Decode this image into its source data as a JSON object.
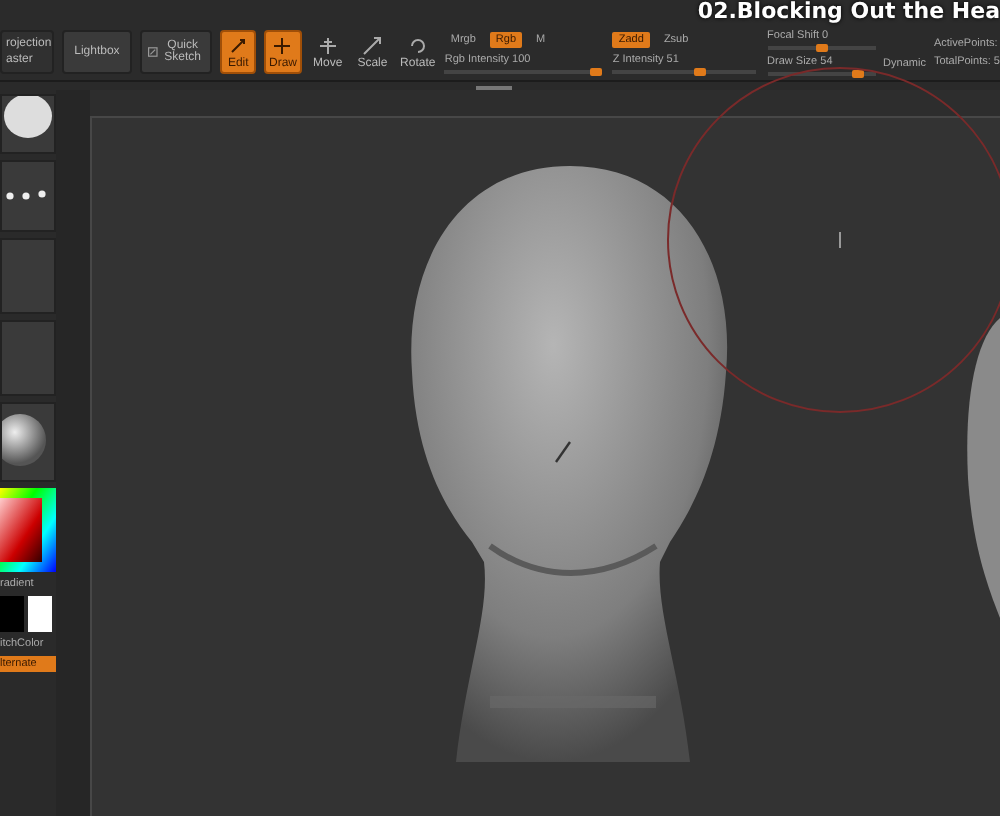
{
  "projection_lines": [
    "rojection",
    "aster"
  ],
  "wide_buttons": [
    {
      "kind": "plain",
      "label": "Lightbox"
    },
    {
      "kind": "sketch",
      "label": "Quick Sketch"
    }
  ],
  "tools": [
    {
      "kind": "edit",
      "label": "Edit",
      "selected": true
    },
    {
      "kind": "draw",
      "label": "Draw",
      "selected": true
    },
    {
      "kind": "move",
      "label": "Move",
      "selected": false
    },
    {
      "kind": "scale",
      "label": "Scale",
      "selected": false
    },
    {
      "kind": "rotate",
      "label": "Rotate",
      "selected": false
    }
  ],
  "color_modes": [
    {
      "label": "Mrgb",
      "selected": false
    },
    {
      "label": "Rgb",
      "selected": true
    },
    {
      "label": "M",
      "selected": false
    }
  ],
  "rgb_intensity": {
    "label": "Rgb Intensity 100",
    "level": 1
  },
  "depth_modes": [
    {
      "label": "Zadd",
      "selected": true
    },
    {
      "label": "Zsub",
      "selected": false
    }
  ],
  "z_intensity": {
    "label": "Z Intensity 51",
    "level": 0.6
  },
  "focal_shift": {
    "label": "Focal Shift 0",
    "level": 0.5
  },
  "draw_size": {
    "label": "Draw Size 54",
    "level": 0.85
  },
  "dynamic": "Dynamic",
  "points": [
    "ActivePoints:",
    "TotalPoints: 5"
  ],
  "left_panel": {
    "gradient_label": "radient",
    "switch_label": "itchColor",
    "alternate_label": "lternate"
  },
  "caption": "02.Blocking Out the Hea"
}
